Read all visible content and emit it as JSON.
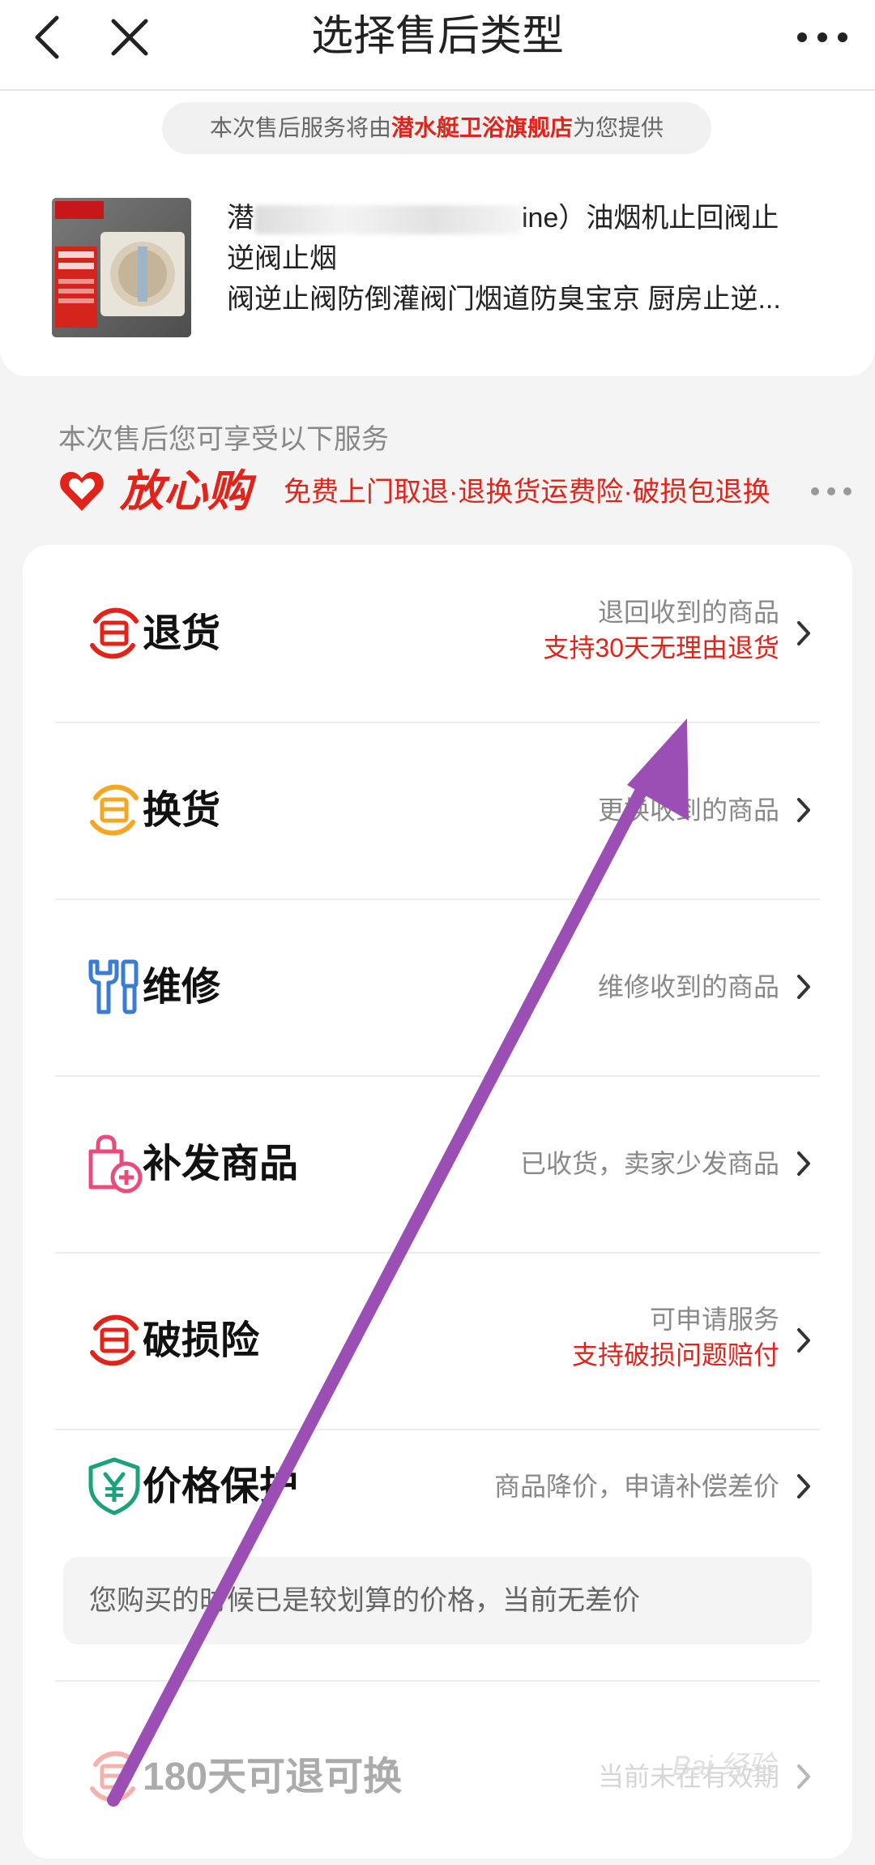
{
  "header": {
    "title": "选择售后类型"
  },
  "provider": {
    "prefix": "本次售后服务将由",
    "shop": "潜水艇卫浴旗舰店",
    "suffix": "为您提供"
  },
  "product": {
    "title_line1_start": "潜",
    "title_line1_mid": "ine）",
    "title_line1_end": "油烟机止回阀止逆阀止烟",
    "title_line2": "阀逆止阀防倒灌阀门烟道防臭宝京 厨房止逆..."
  },
  "services": {
    "label": "本次售后您可享受以下服务",
    "brand": "放心购",
    "features": "免费上门取退·退换货运费险·破损包退换"
  },
  "options": [
    {
      "label": "退货",
      "desc": "退回收到的商品",
      "desc2": "支持30天无理由退货"
    },
    {
      "label": "换货",
      "desc": "更换收到的商品"
    },
    {
      "label": "维修",
      "desc": "维修收到的商品"
    },
    {
      "label": "补发商品",
      "desc": "已收货，卖家少发商品"
    },
    {
      "label": "破损险",
      "desc": "可申请服务",
      "desc2": "支持破损问题赔付"
    },
    {
      "label": "价格保护",
      "desc": "商品降价，申请补偿差价",
      "note": "您购买的时候已是较划算的价格，当前无差价"
    },
    {
      "label": "180天可退可换",
      "desc": "当前未在有效期"
    }
  ],
  "watermark": "Bai 经验",
  "colors": {
    "accent_red": "#e2231a",
    "exchange_orange": "#f5a623",
    "repair_blue": "#3a7bd5",
    "reissue_pink": "#e94c7a",
    "price_green": "#1aa37a",
    "arrow_purple": "#9b4fb5"
  },
  "icons": {
    "back": "back-icon",
    "close": "close-icon",
    "more": "more-icon",
    "heart": "heart-icon"
  }
}
